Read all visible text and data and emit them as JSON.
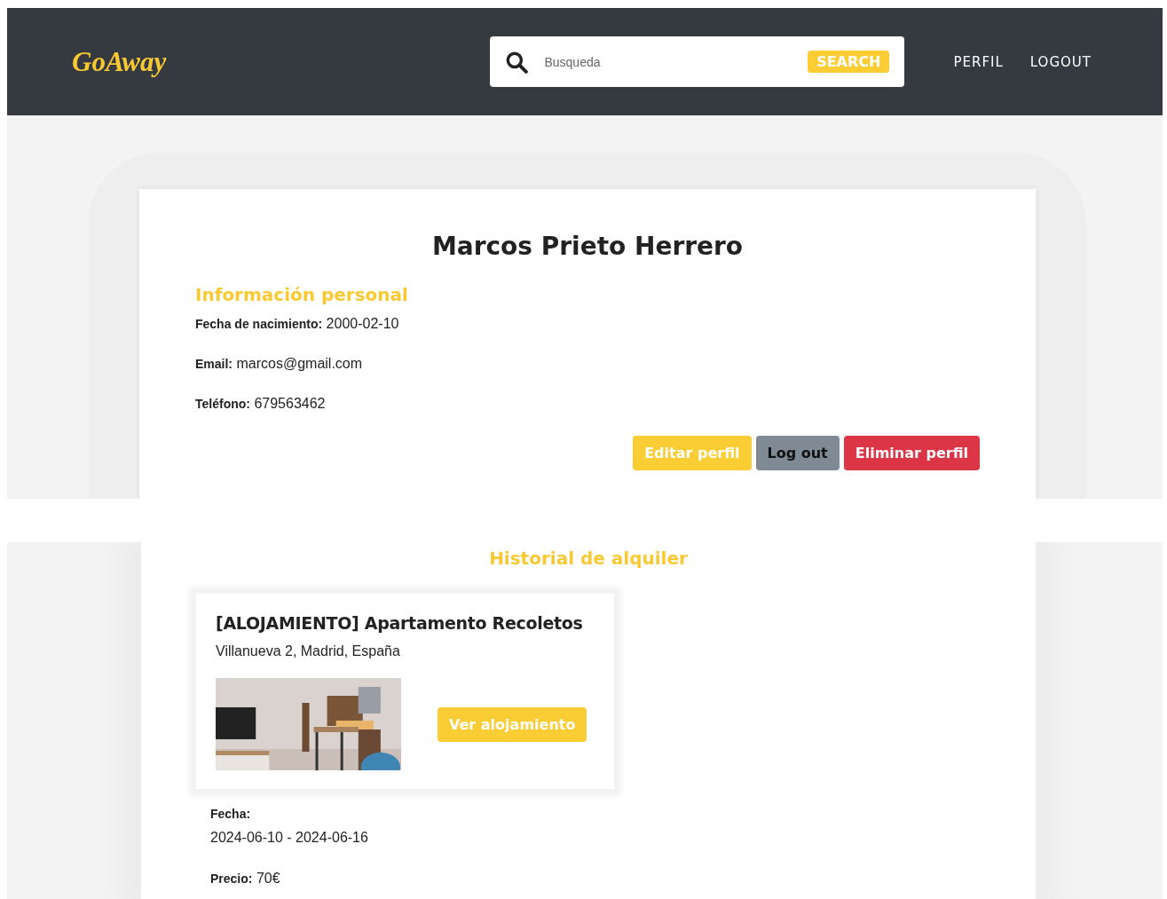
{
  "brand": "GoAway",
  "search": {
    "placeholder": "Busqueda",
    "button": "SEARCH"
  },
  "nav": [
    "PERFIL",
    "LOGOUT"
  ],
  "profile": {
    "name": "Marcos Prieto Herrero",
    "section_title": "Información personal",
    "fields": [
      {
        "label": "Fecha de nacimiento:",
        "value": "2000-02-10"
      },
      {
        "label": "Email:",
        "value": "marcos@gmail.com"
      },
      {
        "label": "Teléfono:",
        "value": "679563462"
      }
    ],
    "buttons": [
      {
        "label": "Editar perfil",
        "kind": "warning"
      },
      {
        "label": "Log out",
        "kind": "secondary"
      },
      {
        "label": "Eliminar perfil",
        "kind": "danger"
      }
    ]
  },
  "history": {
    "title": "Historial de alquiler",
    "rentals": [
      {
        "title": "[ALOJAMIENTO] Apartamento Recoletos",
        "address": "Villanueva 2, Madrid, España",
        "button": "Ver alojamiento",
        "date_label": "Fecha:",
        "dates": "2024-06-10 - 2024-06-16",
        "price_label": "Precio:",
        "price": "70€"
      }
    ]
  }
}
